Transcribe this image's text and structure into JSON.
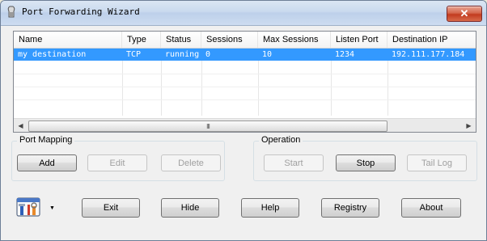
{
  "window": {
    "title": "Port Forwarding Wizard",
    "close_glyph": "✕"
  },
  "list": {
    "columns": [
      "Name",
      "Type",
      "Status",
      "Sessions",
      "Max Sessions",
      "Listen Port",
      "Destination IP"
    ],
    "rows": [
      {
        "cells": [
          "my destination",
          "TCP",
          "running",
          "0",
          "10",
          "1234",
          "192.111.177.184"
        ],
        "selected": true
      }
    ],
    "scroll_grip": "III"
  },
  "port_mapping": {
    "legend": "Port Mapping",
    "add": "Add",
    "edit": "Edit",
    "delete": "Delete"
  },
  "operation": {
    "legend": "Operation",
    "start": "Start",
    "stop": "Stop",
    "tail_log": "Tail Log"
  },
  "bottom": {
    "exit": "Exit",
    "hide": "Hide",
    "help": "Help",
    "registry": "Registry",
    "about": "About"
  },
  "colors": {
    "selection": "#3399ff",
    "close": "#c23b1f"
  },
  "icons": {
    "app": "app-icon",
    "tools": "tools-icon",
    "dropdown": "chevron-down-icon"
  }
}
